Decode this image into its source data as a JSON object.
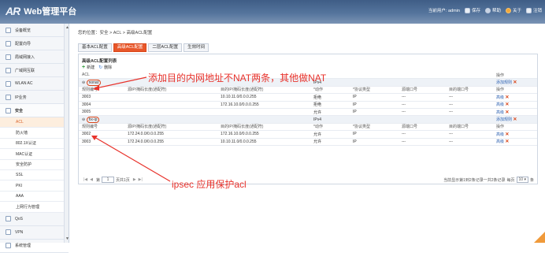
{
  "header": {
    "logo_mark": "AR",
    "title": "Web管理平台",
    "current_user": "当前用户: admin",
    "buttons": [
      "保存",
      "帮助",
      "关于",
      "注销"
    ]
  },
  "sidebar": {
    "items_top": [
      "设备概览",
      "配置向导",
      "局域网接入",
      "广域网互联",
      "WLAN AC",
      "IP业务",
      "安全"
    ],
    "sub_items": [
      "ACL",
      "防火墙",
      "802.1X认证",
      "MAC认证",
      "安全防护",
      "SSL",
      "PKI",
      "AAA",
      "上网行为管理"
    ],
    "items_bottom": [
      "QoS",
      "VPN",
      "系统管理"
    ]
  },
  "main": {
    "breadcrumb": "您的位置：安全 > ACL > 高级ACL配置",
    "tabs": [
      "基本ACL配置",
      "高级ACL配置",
      "二层ACL配置",
      "生效时间"
    ],
    "panel_title": "高级ACL配置列表",
    "toolbar": {
      "new": "新建",
      "delete": "删除"
    },
    "acl_header": {
      "acl": "ACL",
      "ipv": "IPv4",
      "op": "操作"
    },
    "col_headers": [
      "规则编号",
      "源IP/掩码长度(通配符)",
      "目的IP/掩码长度(通配符)",
      "*动作",
      "*协议类型",
      "源端口号",
      "目的端口号",
      "操作"
    ],
    "groups": [
      {
        "name": "nonat",
        "ipv": "IPv4",
        "add_rule": "添加规则",
        "rules": [
          {
            "id": "3003",
            "src": "",
            "dst": "10.10.11.0/0.0.0.255",
            "action": "拒绝",
            "proto": "IP",
            "sport": "---",
            "dport": "---",
            "op": "高级"
          },
          {
            "id": "3004",
            "src": "",
            "dst": "172.16.10.0/0.0.0.255",
            "action": "拒绝",
            "proto": "IP",
            "sport": "---",
            "dport": "---",
            "op": "高级"
          },
          {
            "id": "3005",
            "src": "",
            "dst": "",
            "action": "允许",
            "proto": "IP",
            "sport": "---",
            "dport": "---",
            "op": "高级"
          }
        ]
      },
      {
        "name": "hx-ip",
        "ipv": "IPv4",
        "add_rule": "添加规则",
        "rules": [
          {
            "id": "3002",
            "src": "172.24.0.0/0.0.0.255",
            "dst": "172.16.10.0/0.0.0.255",
            "action": "允许",
            "proto": "IP",
            "sport": "---",
            "dport": "---",
            "op": "高级"
          },
          {
            "id": "3003",
            "src": "172.24.0.0/0.0.0.255",
            "dst": "10.10.11.0/0.0.0.255",
            "action": "允许",
            "proto": "IP",
            "sport": "---",
            "dport": "---",
            "op": "高级"
          }
        ]
      }
    ],
    "pager": {
      "page_prefix": "第",
      "page_value": "1",
      "page_suffix": "页共1页",
      "summary": "当前显示第1到2条记录一共2条记录",
      "per_page_label": "每页",
      "per_page_value": "10",
      "per_page_unit": "条"
    }
  },
  "annotations": {
    "top": "添加目的内网地址不NAT两条，其他做NAT",
    "bottom": "ipsec 应用保护acl"
  },
  "colors": {
    "accent": "#e8572a",
    "annotation": "#e8322b",
    "header": "#54749c"
  }
}
